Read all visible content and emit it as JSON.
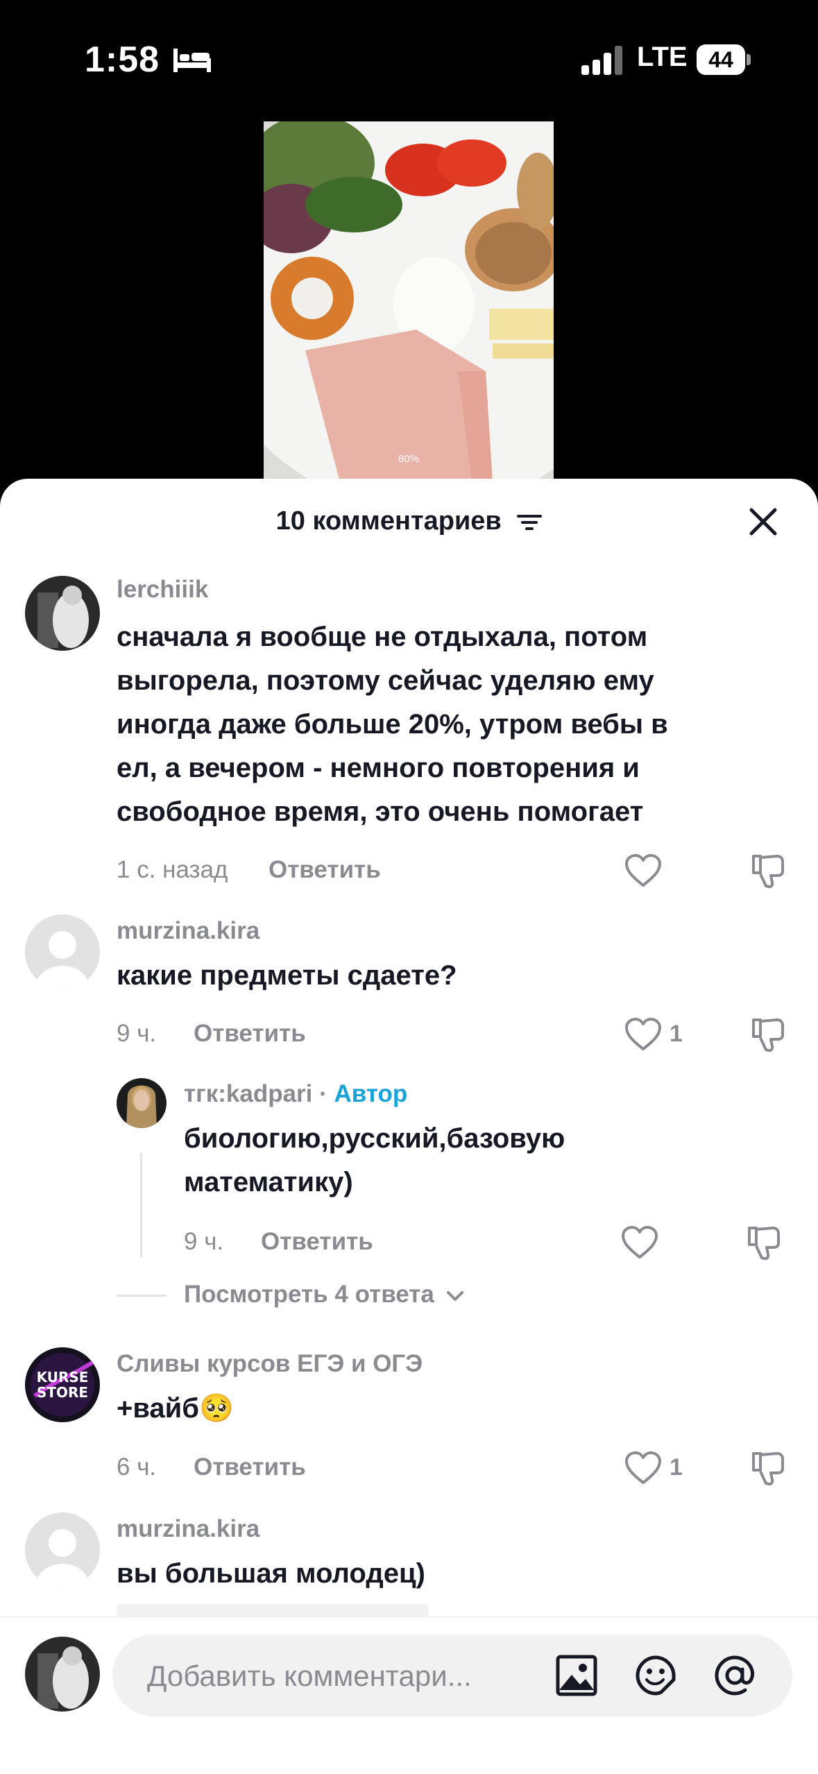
{
  "status_bar": {
    "time": "1:58",
    "network": "LTE",
    "battery": "44"
  },
  "video": {
    "progress_label": "80%"
  },
  "comments_header": {
    "title": "10 комментариев"
  },
  "comments": [
    {
      "username": "lerchiiik",
      "lines": [
        "сначала я вообще не отдыхала, потом",
        "выгорела, поэтому сейчас уделяю ему",
        "иногда даже больше 20%, утром вебы в",
        "ел, а вечером - немного повторения и",
        "свободное время, это очень помогает"
      ],
      "time": "1 с. назад",
      "reply_label": "Ответить",
      "likes": ""
    },
    {
      "username": "murzina.kira",
      "lines": [
        "какие предметы сдаете?"
      ],
      "time": "9 ч.",
      "reply_label": "Ответить",
      "likes": "1",
      "reply": {
        "username": "тгк:kadpari",
        "separator": "·",
        "author_tag": "Автор",
        "lines": [
          "биологию,русский,базовую",
          "математику)"
        ],
        "time": "9 ч.",
        "reply_label": "Ответить"
      },
      "view_replies": "Посмотреть 4 ответа"
    },
    {
      "username": "Сливы курсов ЕГЭ и ОГЭ",
      "lines": [
        "+вайб"
      ],
      "emoji": "🥺",
      "avatar_text": "KURSE STORE",
      "time": "6 ч.",
      "reply_label": "Ответить",
      "likes": "1"
    },
    {
      "username": "murzina.kira",
      "lines": [
        "вы большая молодец)"
      ]
    }
  ],
  "input": {
    "placeholder": "Добавить комментари..."
  },
  "icons": {
    "status": [
      "bed-icon",
      "signal-icon",
      "battery-icon"
    ],
    "header": [
      "filter-icon",
      "close-icon"
    ],
    "comment_actions": [
      "heart-icon",
      "dislike-icon",
      "chevron-down-icon"
    ],
    "input": [
      "image-icon",
      "emoji-icon",
      "mention-icon"
    ]
  },
  "colors": {
    "author_tag": "#19a3d8",
    "secondary_text": "#8a8b91",
    "primary_text": "#161823"
  }
}
